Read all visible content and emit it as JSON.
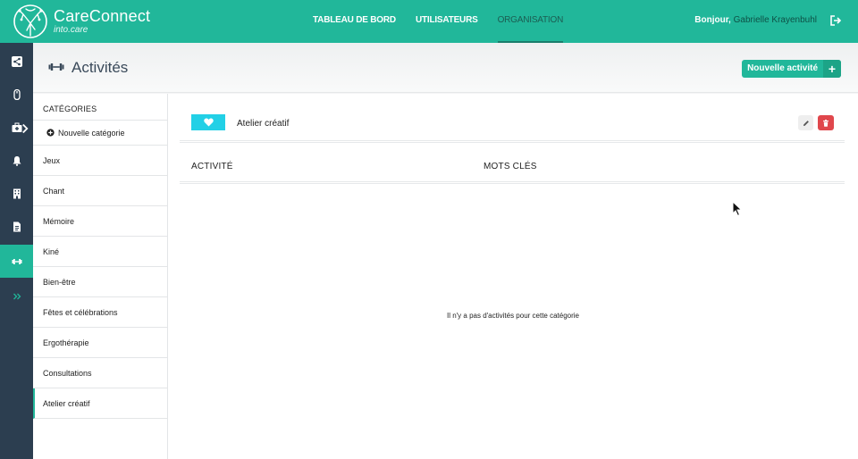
{
  "header": {
    "brand_name": "CareConnect",
    "brand_sub": "into.care",
    "nav": [
      {
        "label": "TABLEAU DE BORD",
        "active": false
      },
      {
        "label": "UTILISATEURS",
        "active": false
      },
      {
        "label": "ORGANISATION",
        "active": true
      }
    ],
    "greeting": "Bonjour,",
    "user_name": "Gabrielle Krayenbuhl"
  },
  "rail": {
    "items": [
      {
        "icon": "share-icon",
        "active": false
      },
      {
        "icon": "mouse-icon",
        "active": false
      },
      {
        "icon": "medkit-icon",
        "active": false,
        "has_caret": true
      },
      {
        "icon": "bell-icon",
        "active": false
      },
      {
        "icon": "building-icon",
        "active": false
      },
      {
        "icon": "document-icon",
        "active": false
      },
      {
        "icon": "dumbbell-icon",
        "active": true
      },
      {
        "icon": "double-chevron-right-icon",
        "active": false
      }
    ]
  },
  "page": {
    "title": "Activités",
    "new_button_label": "Nouvelle activité",
    "new_button_plus": "+"
  },
  "categories": {
    "header": "CATÉGORIES",
    "new_label": "Nouvelle catégorie",
    "items": [
      {
        "label": "Jeux",
        "active": false
      },
      {
        "label": "Chant",
        "active": false
      },
      {
        "label": "Mémoire",
        "active": false
      },
      {
        "label": "Kiné",
        "active": false
      },
      {
        "label": "Bien-être",
        "active": false
      },
      {
        "label": "Fêtes et célébrations",
        "active": false
      },
      {
        "label": "Ergothérapie",
        "active": false
      },
      {
        "label": "Consultations",
        "active": false
      },
      {
        "label": "Atelier créatif",
        "active": true
      }
    ]
  },
  "selected_category": {
    "name": "Atelier créatif",
    "color": "#22d0e6",
    "icon": "heart-icon"
  },
  "table": {
    "col_activity": "ACTIVITÉ",
    "col_keywords": "MOTS CLÉS",
    "empty_message": "Il n'y a pas d'activités pour cette catégorie"
  },
  "colors": {
    "brand": "#21b79a",
    "rail": "#2c3e50",
    "danger": "#e0474c"
  }
}
